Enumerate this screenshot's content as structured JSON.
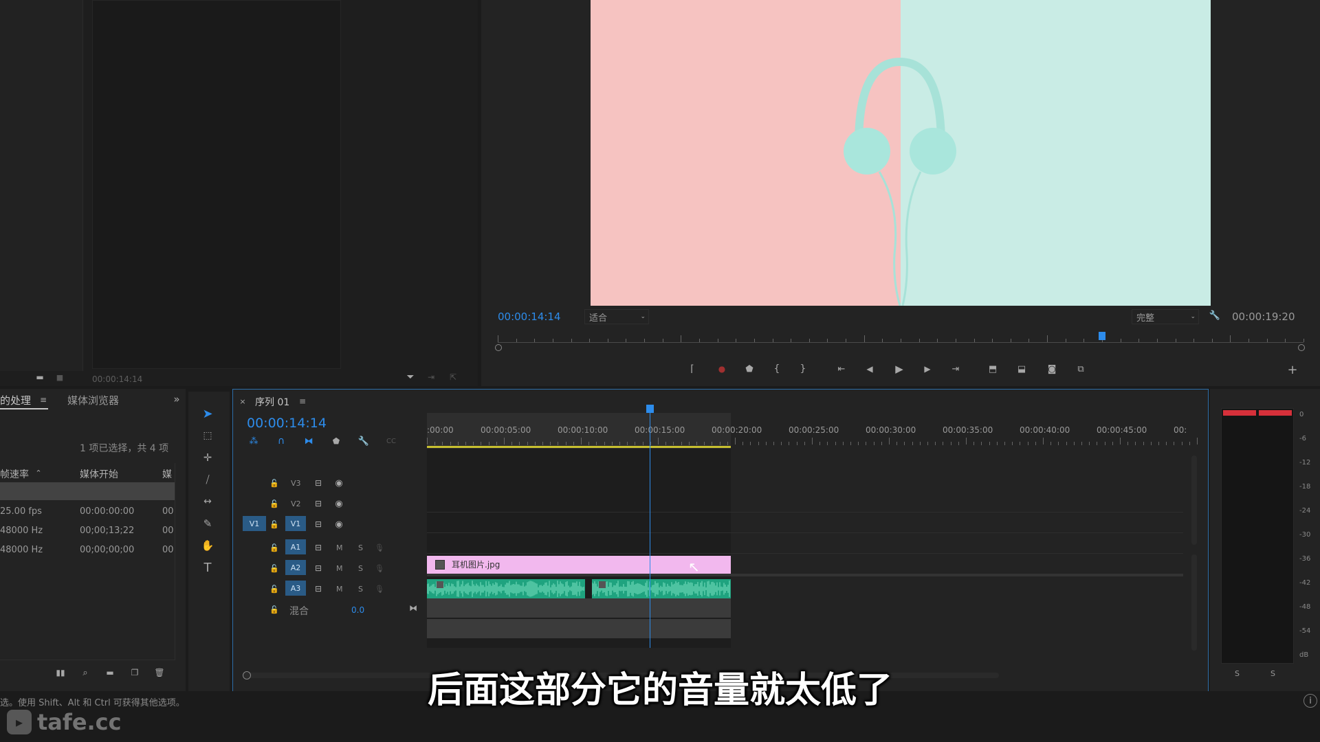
{
  "source_monitor": {
    "timecode": "00:00:14:14"
  },
  "program_monitor": {
    "timecode_current": "00:00:14:14",
    "fit_label": "适合",
    "quality_label": "完整",
    "timecode_end": "00:00:19:20",
    "playhead_fraction": 0.73
  },
  "project_panel": {
    "tab_active": "的处理",
    "tab_media_browser": "媒体浏览器",
    "selection_info": "1 项已选择，共 4 项",
    "columns": [
      "帧速率",
      "媒体开始",
      "媒"
    ],
    "rows": [
      {
        "rate": "25.00 fps",
        "start": "00:00:00:00",
        "extra": "00"
      },
      {
        "rate": "48000 Hz",
        "start": "00;00;13;22",
        "extra": "00"
      },
      {
        "rate": "48000 Hz",
        "start": "00;00;00;00",
        "extra": "00"
      }
    ]
  },
  "timeline": {
    "sequence_tab": "序列 01",
    "timecode": "00:00:14:14",
    "ruler_labels": [
      ":00:00",
      "00:00:05:00",
      "00:00:10:00",
      "00:00:15:00",
      "00:00:20:00",
      "00:00:25:00",
      "00:00:30:00",
      "00:00:35:00",
      "00:00:40:00",
      "00:00:45:00",
      "00:"
    ],
    "video_tracks": [
      {
        "name": "V3",
        "source": ""
      },
      {
        "name": "V2",
        "source": ""
      },
      {
        "name": "V1",
        "source": "V1"
      }
    ],
    "audio_tracks": [
      {
        "name": "A1",
        "m": "M",
        "s": "S"
      },
      {
        "name": "A2",
        "m": "M",
        "s": "S"
      },
      {
        "name": "A3",
        "m": "M",
        "s": "S"
      }
    ],
    "mix_label": "混合",
    "mix_value": "0.0",
    "clip_name": "耳机图片.jpg"
  },
  "audio_meter": {
    "scale": [
      "0",
      "-6",
      "-12",
      "-18",
      "-24",
      "-30",
      "-36",
      "-42",
      "-48",
      "-54",
      "dB"
    ],
    "solo_left": "S",
    "solo_right": "S"
  },
  "status_bar": {
    "hint": "选。使用 Shift、Alt 和 Ctrl 可获得其他选项。"
  },
  "subtitle": "后面这部分它的音量就太低了",
  "watermark": "tafe.cc",
  "colors": {
    "accent": "#2d8ceb",
    "clip_video": "#f2b8ee",
    "clip_audio": "#1fa37f",
    "meter_red": "#d6303a"
  }
}
